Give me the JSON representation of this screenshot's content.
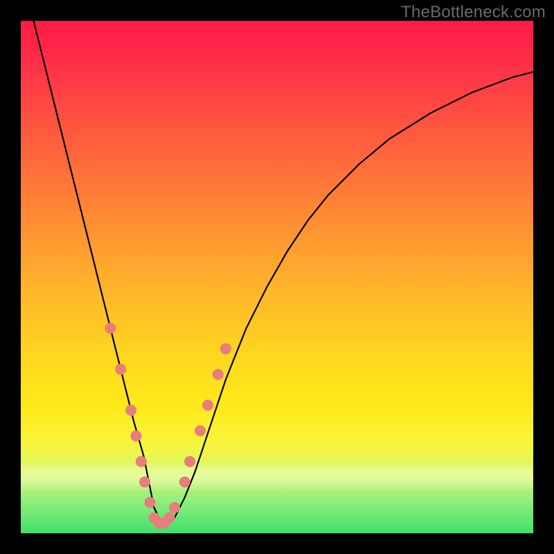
{
  "watermark": "TheBottleneck.com",
  "chart_data": {
    "type": "line",
    "title": "",
    "xlabel": "",
    "ylabel": "",
    "xlim": [
      0,
      100
    ],
    "ylim": [
      0,
      100
    ],
    "grid": false,
    "legend": false,
    "series": [
      {
        "name": "bottleneck-curve",
        "x": [
          0,
          2,
          4,
          6,
          8,
          10,
          12,
          14,
          16,
          18,
          20,
          22,
          24,
          25,
          26,
          27,
          28,
          30,
          32,
          34,
          36,
          38,
          40,
          44,
          48,
          52,
          56,
          60,
          66,
          72,
          80,
          88,
          96,
          100
        ],
        "y": [
          110,
          102,
          94,
          86,
          78,
          70,
          62,
          54,
          46,
          38,
          30,
          22,
          15,
          10,
          5,
          3,
          2,
          3,
          7,
          12,
          18,
          24,
          30,
          40,
          48,
          55,
          61,
          66,
          72,
          77,
          82,
          86,
          89,
          90
        ]
      }
    ],
    "markers": {
      "name": "highlight-dots",
      "color": "#e97c7c",
      "points": [
        {
          "x": 17.5,
          "y": 40
        },
        {
          "x": 19.5,
          "y": 32
        },
        {
          "x": 21.5,
          "y": 24
        },
        {
          "x": 22.5,
          "y": 19
        },
        {
          "x": 23.5,
          "y": 14
        },
        {
          "x": 24.2,
          "y": 10
        },
        {
          "x": 25.2,
          "y": 6
        },
        {
          "x": 26.0,
          "y": 3
        },
        {
          "x": 27.0,
          "y": 2
        },
        {
          "x": 28.0,
          "y": 2
        },
        {
          "x": 29.0,
          "y": 3
        },
        {
          "x": 30.0,
          "y": 5
        },
        {
          "x": 32.0,
          "y": 10
        },
        {
          "x": 33.0,
          "y": 14
        },
        {
          "x": 35.0,
          "y": 20
        },
        {
          "x": 36.5,
          "y": 25
        },
        {
          "x": 38.5,
          "y": 31
        },
        {
          "x": 40.0,
          "y": 36
        }
      ]
    },
    "background_gradient": {
      "top": "#ff1a45",
      "mid": "#ffd61f",
      "bottom": "#3fe06e"
    }
  }
}
